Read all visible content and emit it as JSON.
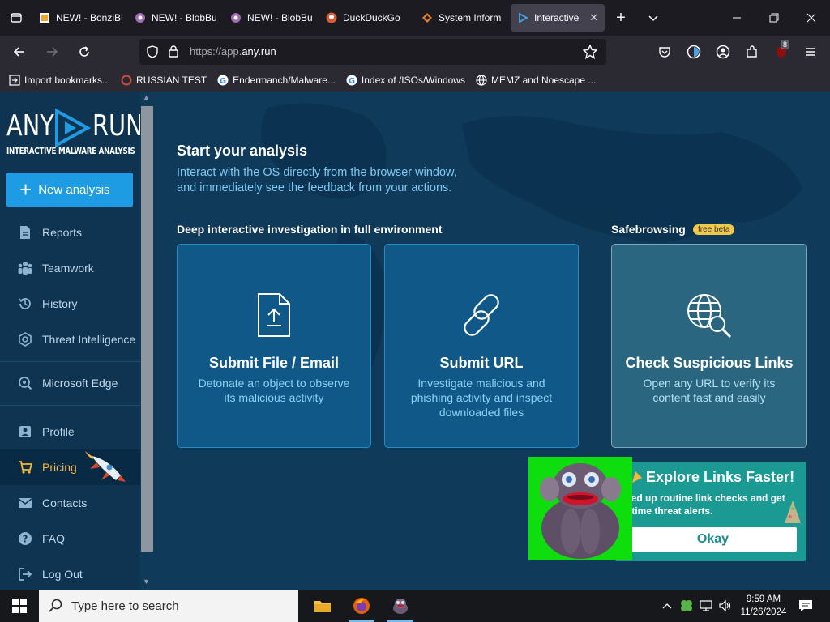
{
  "browser": {
    "tabs": [
      {
        "title": "NEW! - BonziBUDD",
        "icon": "bonzi-icon"
      },
      {
        "title": "NEW! - BlobBu",
        "icon": "blobbu-icon"
      },
      {
        "title": "NEW! - BlobBu",
        "icon": "blobbu-icon"
      },
      {
        "title": "DuckDuckGo",
        "icon": "duckduckgo-icon"
      },
      {
        "title": "System Inform",
        "icon": "diamond-icon"
      },
      {
        "title": "Interactive",
        "icon": "anyrun-icon",
        "active": true
      }
    ],
    "url_prefix": "https://app.",
    "url_domain": "any.run",
    "extension_badge": "8",
    "bookmarks": [
      {
        "label": "Import bookmarks...",
        "icon": "import-icon"
      },
      {
        "label": "RUSSIAN TEST",
        "icon": "ring-icon"
      },
      {
        "label": "Endermanch/Malware...",
        "icon": "google-icon"
      },
      {
        "label": "Index of /ISOs/Windows",
        "icon": "google-icon"
      },
      {
        "label": "MEMZ and Noescape ...",
        "icon": "globe-icon"
      }
    ]
  },
  "sidebar": {
    "logo_left": "ANY",
    "logo_right": "RUN",
    "tagline": "INTERACTIVE MALWARE ANALYSIS",
    "new_analysis": "New analysis",
    "items": [
      {
        "label": "Reports",
        "icon": "document-icon"
      },
      {
        "label": "Teamwork",
        "icon": "team-icon"
      },
      {
        "label": "History",
        "icon": "history-icon"
      },
      {
        "label": "Threat Intelligence",
        "icon": "intel-icon"
      },
      {
        "label": "Microsoft Edge",
        "icon": "edge-search-icon"
      },
      {
        "label": "Profile",
        "icon": "profile-icon"
      },
      {
        "label": "Pricing",
        "icon": "cart-icon"
      },
      {
        "label": "Contacts",
        "icon": "mail-icon"
      },
      {
        "label": "FAQ",
        "icon": "help-icon"
      },
      {
        "label": "Log Out",
        "icon": "logout-icon"
      }
    ]
  },
  "main": {
    "title": "Start your analysis",
    "subtitle_line1": "Interact with the OS directly from the browser window,",
    "subtitle_line2": "and immediately see the feedback from your actions.",
    "section_left": "Deep interactive investigation in full environment",
    "section_right": "Safebrowsing",
    "beta_badge": "free beta",
    "cards": [
      {
        "title": "Submit File / Email",
        "desc": "Detonate an object to observe its malicious activity",
        "icon": "file-upload-icon"
      },
      {
        "title": "Submit URL",
        "desc": "Investigate malicious and phishing activity and inspect downloaded files",
        "icon": "link-icon"
      },
      {
        "title": "Check Suspicious Links",
        "desc": "Open any URL to verify its content fast and easily",
        "icon": "globe-search-icon"
      }
    ]
  },
  "promo": {
    "title": "Explore Links Faster!",
    "line1": "eed up routine link checks and get",
    "line2": "l-time threat alerts.",
    "button": "Okay"
  },
  "taskbar": {
    "search_placeholder": "Type here to search",
    "time": "9:59 AM",
    "date": "11/26/2024"
  }
}
